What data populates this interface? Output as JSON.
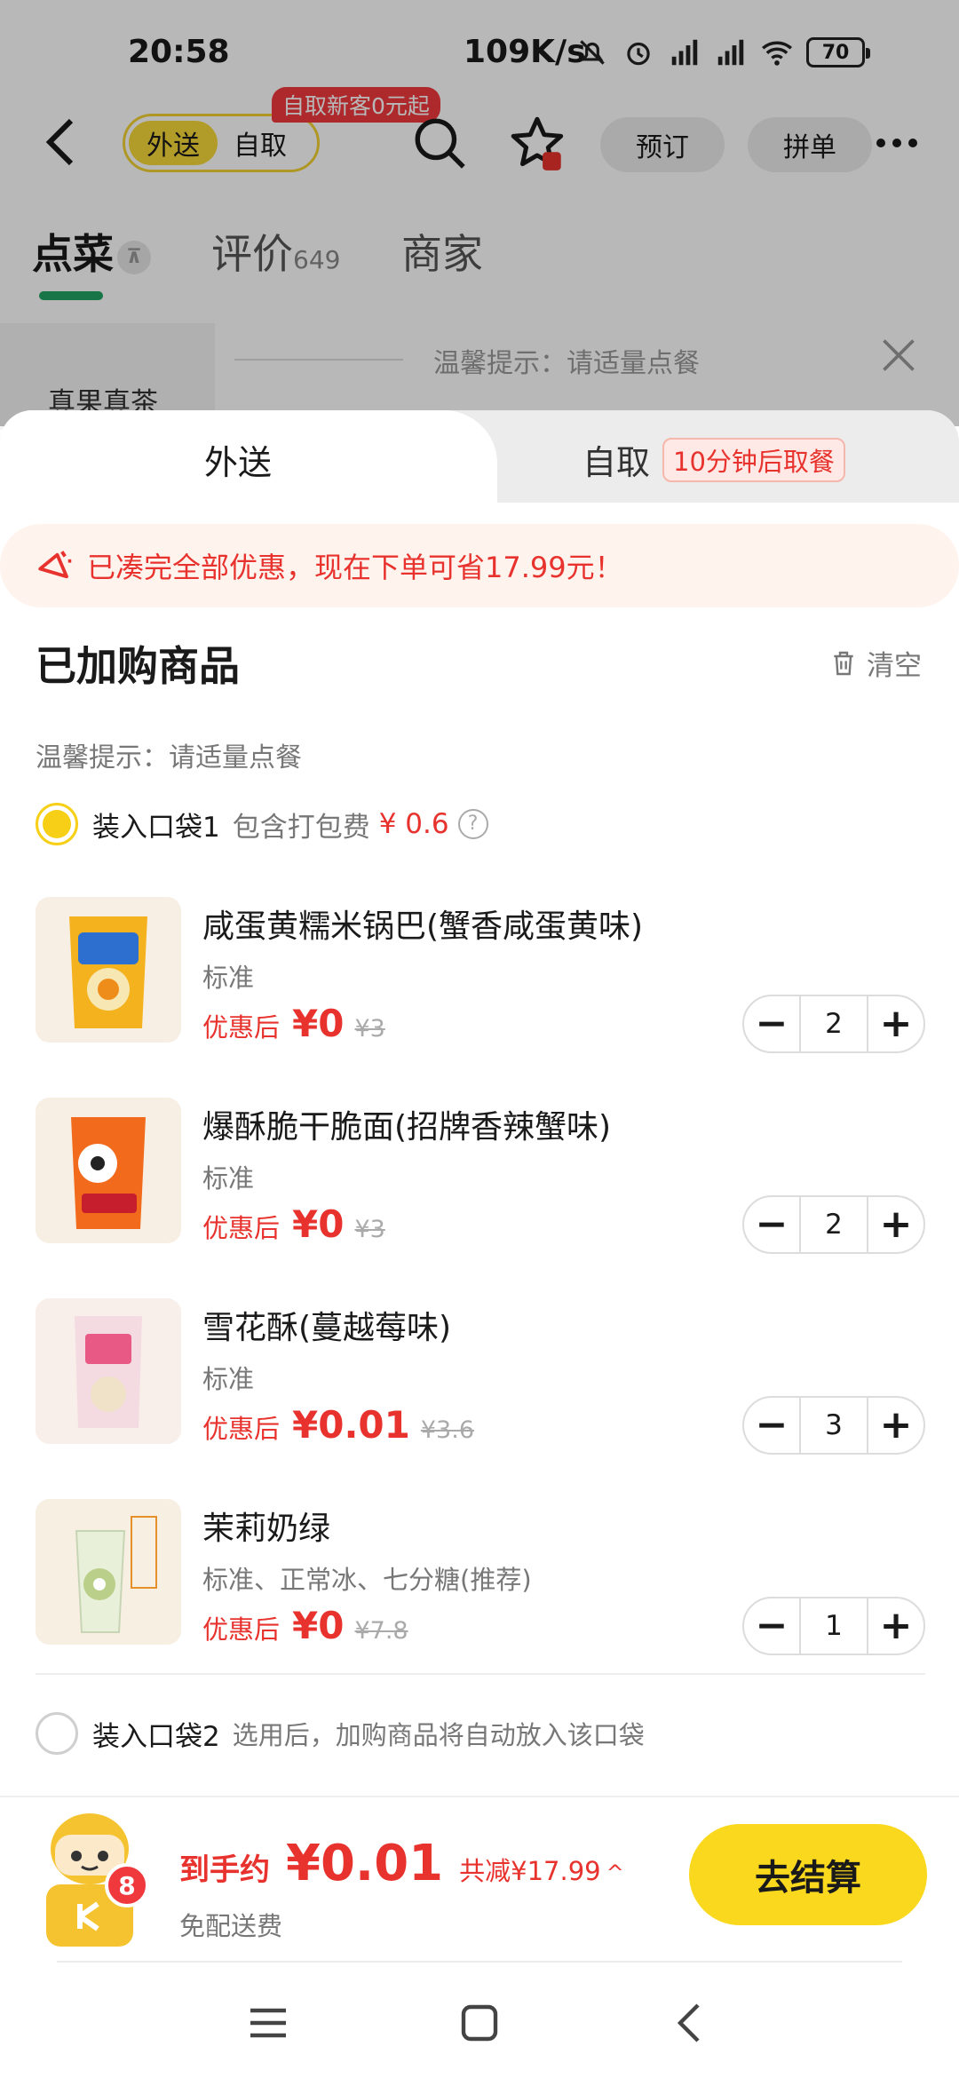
{
  "status_bar": {
    "time": "20:58",
    "network_speed": "109K/s",
    "battery": "70"
  },
  "nav": {
    "mode_tabs": [
      "外送",
      "自取"
    ],
    "promo_tag": "自取新客0元起",
    "reserve_label": "预订",
    "group_label": "拼单"
  },
  "store_tabs": {
    "order_label": "点菜",
    "pin_symbol": "⊼",
    "reviews_label": "评价",
    "reviews_count": "649",
    "merchant_label": "商家"
  },
  "background": {
    "category": "真果真茶",
    "tip": "温馨提示：请适量点餐"
  },
  "sheet": {
    "tab_delivery": "外送",
    "tab_pickup": "自取",
    "pickup_badge": "10分钟后取餐",
    "banner_text": "已凑完全部优惠，现在下单可省17.99元！",
    "cart_title": "已加购商品",
    "clear_label": "清空",
    "tip": "温馨提示：请适量点餐",
    "bag1_label": "装入口袋1",
    "bag1_fee_label": "包含打包费",
    "bag1_fee": "¥ 0.6",
    "help_symbol": "?",
    "bag2_label": "装入口袋2",
    "bag2_note": "选用后，加购商品将自动放入该口袋"
  },
  "items": [
    {
      "name": "咸蛋黄糯米锅巴(蟹香咸蛋黄味)",
      "spec": "标准",
      "price_label": "优惠后",
      "price": "¥0",
      "original_price": "¥3",
      "qty": "2"
    },
    {
      "name": "爆酥脆干脆面(招牌香辣蟹味)",
      "spec": "标准",
      "price_label": "优惠后",
      "price": "¥0",
      "original_price": "¥3",
      "qty": "2"
    },
    {
      "name": "雪花酥(蔓越莓味)",
      "spec": "标准",
      "price_label": "优惠后",
      "price": "¥0.01",
      "original_price": "¥3.6",
      "qty": "3"
    },
    {
      "name": "茉莉奶绿",
      "spec": "标准、正常冰、七分糖(推荐)",
      "price_label": "优惠后",
      "price": "¥0",
      "original_price": "¥7.8",
      "qty": "1"
    }
  ],
  "checkout": {
    "item_count": "8",
    "total_label": "到手约",
    "total_price": "¥0.01",
    "savings": "共减¥17.99",
    "caret": "^",
    "delivery_note": "免配送费",
    "pay_label": "去结算"
  },
  "colors": {
    "accent_yellow": "#f9d81d",
    "price_red": "#e8322d",
    "tab_green": "#21a265"
  }
}
